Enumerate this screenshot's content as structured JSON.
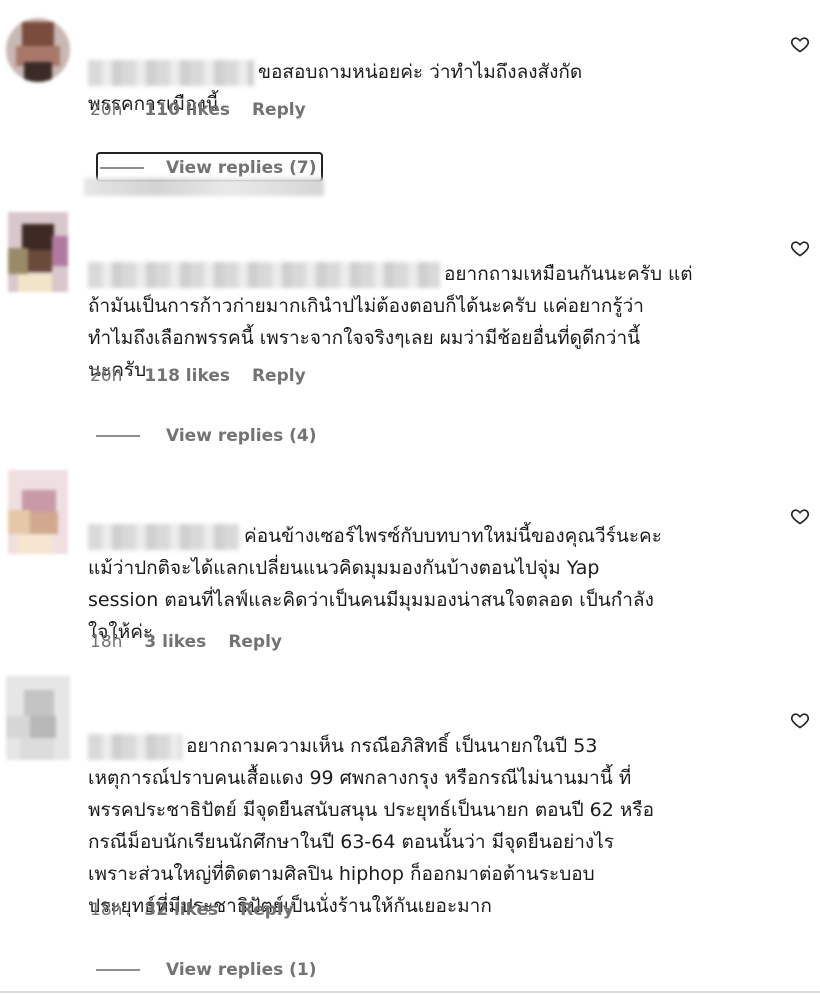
{
  "comments": [
    {
      "text": "ขอสอบถามหน่อยค่ะ ว่าทำไมถึงลงสังกัด\nพรรคการเมืองนี้",
      "time": "20h",
      "likes": "110 likes",
      "reply": "Reply",
      "view_replies": "View replies (7)"
    },
    {
      "text": "อยากถามเหมือนกันนะครับ แต่\nถ้ามันเป็นการก้าวก่ายมากเกินำปไม่ต้องตอบก็ได้นะครับ แค่อยากรู้ว่า\nทำไมถึงเลือกพรรคนี้ เพราะจากใจจริงๆเลย ผมว่ามีช้อยอื่นที่ดูดีกว่านี้\nนะครับ",
      "time": "20h",
      "likes": "118 likes",
      "reply": "Reply",
      "view_replies": "View replies (4)"
    },
    {
      "text": "ค่อนข้างเซอร์ไพรซ์กับบทบาทใหม่นี้ของคุณวีร์นะคะ\nแม้ว่าปกติจะได้แลกเปลี่ยนแนวคิดมุมมองกันบ้างตอนไปจุ่ม Yap\nsession ตอนที่ไลฟ์และคิดว่าเป็นคนมีมุมมองน่าสนใจตลอด เป็นกำลัง\nใจให้ค่ะ",
      "time": "18h",
      "likes": "3 likes",
      "reply": "Reply"
    },
    {
      "text": "อยากถามความเห็น กรณีอภิสิทธิ์ เป็นนายกในปี 53\nเหตุการณ์ปราบคนเสื้อแดง 99 ศพกลางกรุง หรือกรณีไม่นานมานี้ ที่\nพรรคประชาธิปัตย์ มีจุดยืนสนับสนุน ประยุทธ์เป็นนายก ตอนปี 62 หรือ\nกรณีม็อบนักเรียนนักศึกษาในปี 63-64 ตอนนั้นว่า มีจุดยืนอย่างไร\nเพราะส่วนใหญ่ที่ติดตามศิลปิน hiphop ก็ออกมาต่อต้านระบอบ\nประยุทธ์ที่มีประชาธิปัตย์เป็นนั่งร้านให้กันเยอะมาก",
      "time": "18h",
      "likes": "32 likes",
      "reply": "Reply",
      "view_replies": "View replies (1)"
    }
  ],
  "icons": {
    "like": "heart-outline-icon"
  },
  "colors": {
    "text": "#262626",
    "meta": "#737373"
  }
}
